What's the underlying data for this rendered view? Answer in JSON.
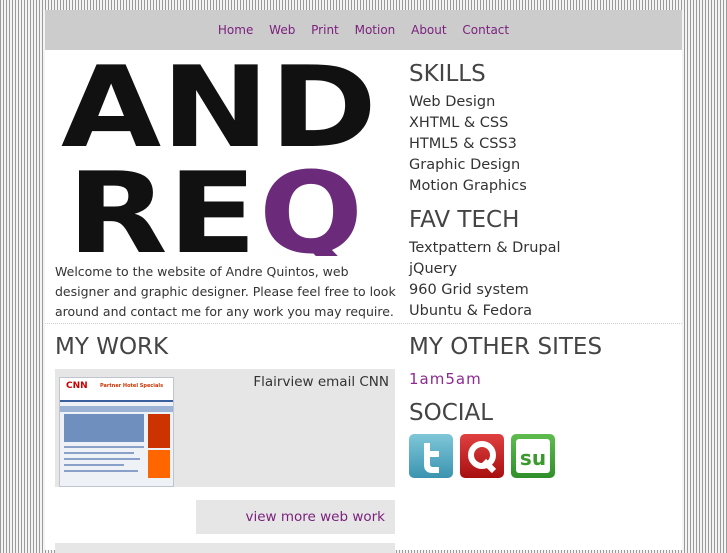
{
  "nav": [
    "Home",
    "Web",
    "Print",
    "Motion",
    "About",
    "Contact"
  ],
  "logo": {
    "line1": "AND",
    "line2_a": "RE",
    "line2_b": "Q"
  },
  "intro": "Welcome to the website of Andre Quintos, web designer and graphic designer. Please feel free to look around and contact me for any work you may require.",
  "skills": {
    "title": "SKILLS",
    "items": [
      "Web Design",
      "XHTML & CSS",
      "HTML5 & CSS3",
      "Graphic Design",
      "Motion Graphics"
    ]
  },
  "fav_tech": {
    "title": "FAV TECH",
    "items": [
      "Textpattern & Drupal",
      "jQuery",
      "960 Grid system",
      "Ubuntu & Fedora"
    ]
  },
  "my_work": {
    "title": "MY WORK",
    "item_title": "Flairview email CNN",
    "thumb_text": {
      "brand": "CNN",
      "heading": "Partner Hotel Specials"
    },
    "more_label": "view more web work"
  },
  "other_sites": {
    "title": "MY OTHER SITES",
    "link": "1am5am"
  },
  "social": {
    "title": "SOCIAL",
    "icons": [
      "twitter-icon",
      "qik-icon",
      "stumbleupon-icon"
    ]
  },
  "colors": {
    "accent": "#7a1f7c",
    "logo_q": "#6b2a7a",
    "nav_bg": "#cccccc"
  }
}
